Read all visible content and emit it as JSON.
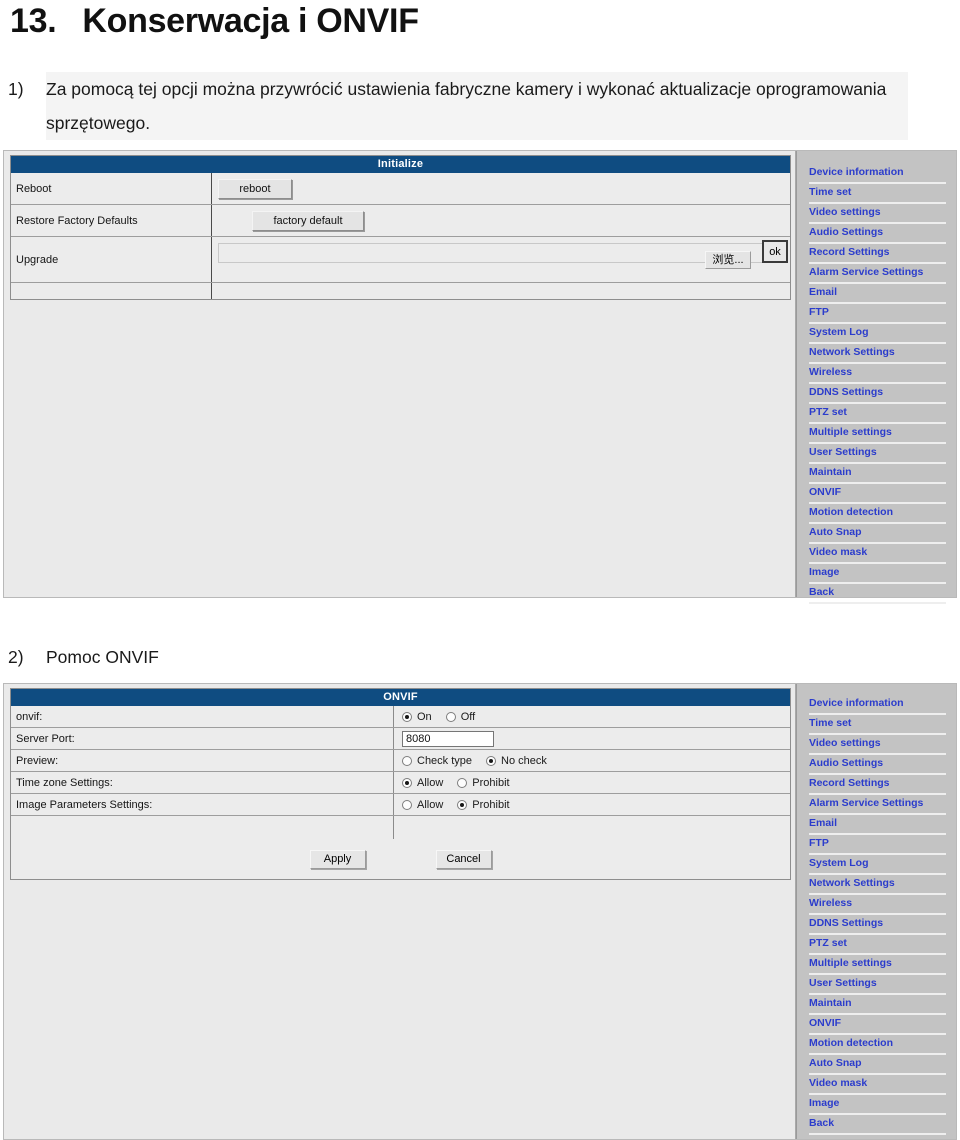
{
  "document": {
    "section_number": "13.",
    "section_title": "Konserwacja i ONVIF",
    "item1_marker": "1)",
    "item1_text": "Za pomocą tej opcji można przywrócić ustawienia fabryczne kamery i wykonać aktualizacje oprogramowania sprzętowego.",
    "item2_marker": "2)",
    "item2_text": "Pomoc ONVIF"
  },
  "colors": {
    "titlebar_blue": "#0f4c81",
    "nav_link_blue": "#2b3ccc",
    "panel_grey": "#ececec",
    "nav_bg_grey": "#c3c3c3"
  },
  "panel1": {
    "titlebar": "Initialize",
    "rows": [
      {
        "label": "Reboot",
        "button": "reboot"
      },
      {
        "label": "Restore Factory Defaults",
        "button": "factory default"
      },
      {
        "label": "Upgrade",
        "browse_button": "浏览...",
        "ok_button": "ok",
        "file_value": ""
      }
    ]
  },
  "panel2": {
    "titlebar": "ONVIF",
    "rows": [
      {
        "label": "onvif:",
        "type": "radio",
        "options": [
          {
            "label": "On",
            "selected": true
          },
          {
            "label": "Off",
            "selected": false
          }
        ]
      },
      {
        "label": "Server Port:",
        "type": "text",
        "value": "8080"
      },
      {
        "label": "Preview:",
        "type": "radio",
        "options": [
          {
            "label": "Check type",
            "selected": false
          },
          {
            "label": "No check",
            "selected": true
          }
        ]
      },
      {
        "label": "Time zone Settings:",
        "type": "radio",
        "options": [
          {
            "label": "Allow",
            "selected": true
          },
          {
            "label": "Prohibit",
            "selected": false
          }
        ]
      },
      {
        "label": "Image Parameters Settings:",
        "type": "radio",
        "options": [
          {
            "label": "Allow",
            "selected": false
          },
          {
            "label": "Prohibit",
            "selected": true
          }
        ]
      }
    ],
    "apply_button": "Apply",
    "cancel_button": "Cancel"
  },
  "nav": {
    "items": [
      "Device information",
      "Time set",
      "Video settings",
      "Audio Settings",
      "Record Settings",
      "Alarm Service Settings",
      "Email",
      "FTP",
      "System Log",
      "Network Settings",
      "Wireless",
      "DDNS Settings",
      "PTZ set",
      "Multiple settings",
      "User Settings",
      "Maintain",
      "ONVIF",
      "Motion detection",
      "Auto Snap",
      "Video mask",
      "Image",
      "Back"
    ]
  }
}
